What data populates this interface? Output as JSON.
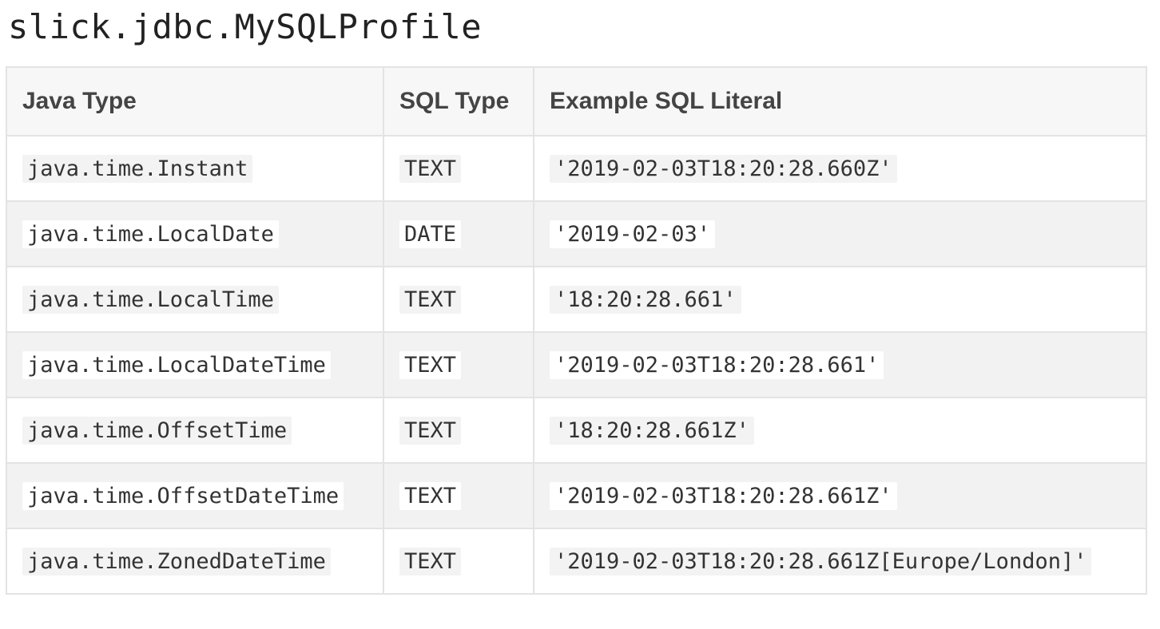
{
  "page": {
    "title": "slick.jdbc.MySQLProfile"
  },
  "table": {
    "headers": [
      "Java Type",
      "SQL Type",
      "Example SQL Literal"
    ],
    "rows": [
      [
        "java.time.Instant",
        "TEXT",
        "'2019-02-03T18:20:28.660Z'"
      ],
      [
        "java.time.LocalDate",
        "DATE",
        "'2019-02-03'"
      ],
      [
        "java.time.LocalTime",
        "TEXT",
        "'18:20:28.661'"
      ],
      [
        "java.time.LocalDateTime",
        "TEXT",
        "'2019-02-03T18:20:28.661'"
      ],
      [
        "java.time.OffsetTime",
        "TEXT",
        "'18:20:28.661Z'"
      ],
      [
        "java.time.OffsetDateTime",
        "TEXT",
        "'2019-02-03T18:20:28.661Z'"
      ],
      [
        "java.time.ZonedDateTime",
        "TEXT",
        "'2019-02-03T18:20:28.661Z[Europe/London]'"
      ]
    ]
  }
}
